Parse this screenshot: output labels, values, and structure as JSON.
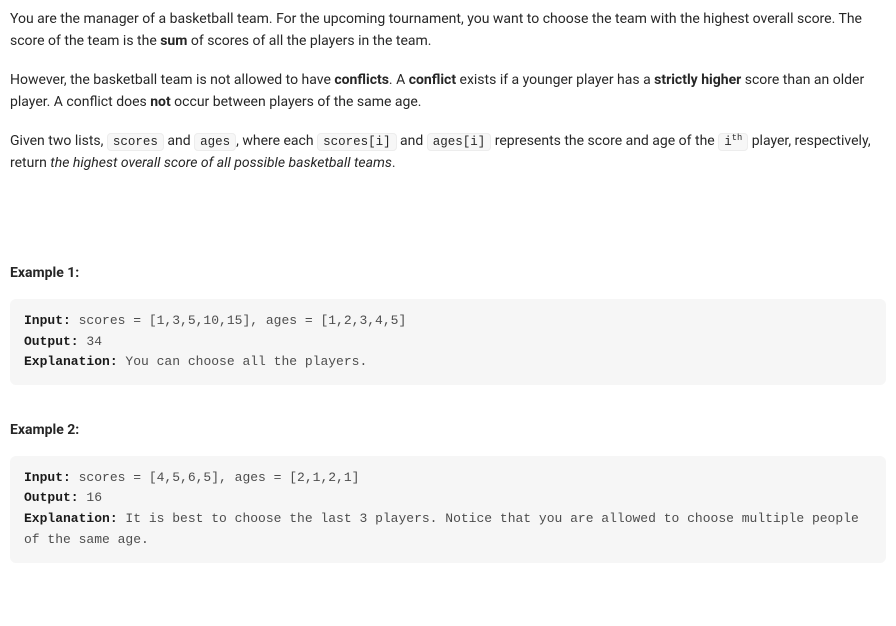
{
  "problem": {
    "p1_part1": "You are the manager of a basketball team. For the upcoming tournament, you want to choose the team with the highest overall score. The score of the team is the ",
    "p1_sum": "sum",
    "p1_part2": " of scores of all the players in the team.",
    "p2_part1": "However, the basketball team is not allowed to have ",
    "p2_conflicts": "conflicts",
    "p2_part2": ". A ",
    "p2_conflict": "conflict",
    "p2_part3": " exists if a younger player has a ",
    "p2_strictly_higher": "strictly higher",
    "p2_part4": " score than an older player. A conflict does ",
    "p2_not": "not",
    "p2_part5": " occur between players of the same age.",
    "p3_part1": "Given two lists, ",
    "p3_code_scores": "scores",
    "p3_part2": " and ",
    "p3_code_ages": "ages",
    "p3_part3": ", where each ",
    "p3_code_scoresi": "scores[i]",
    "p3_part4": " and ",
    "p3_code_agesi": "ages[i]",
    "p3_part5": " represents the score and age of the ",
    "p3_code_ith_i": "i",
    "p3_code_ith_th": "th",
    "p3_part6": " player, respectively, return ",
    "p3_italic": "the highest overall score of all possible basketball teams",
    "p3_part7": "."
  },
  "labels": {
    "input": "Input:",
    "output": "Output:",
    "explanation": "Explanation:"
  },
  "examples": [
    {
      "heading": "Example 1:",
      "input_text": " scores = [1,3,5,10,15], ages = [1,2,3,4,5]",
      "output_text": " 34",
      "explanation_text": " You can choose all the players."
    },
    {
      "heading": "Example 2:",
      "input_text": " scores = [4,5,6,5], ages = [2,1,2,1]",
      "output_text": " 16",
      "explanation_text": " It is best to choose the last 3 players. Notice that you are allowed to choose multiple people of the same age."
    }
  ]
}
